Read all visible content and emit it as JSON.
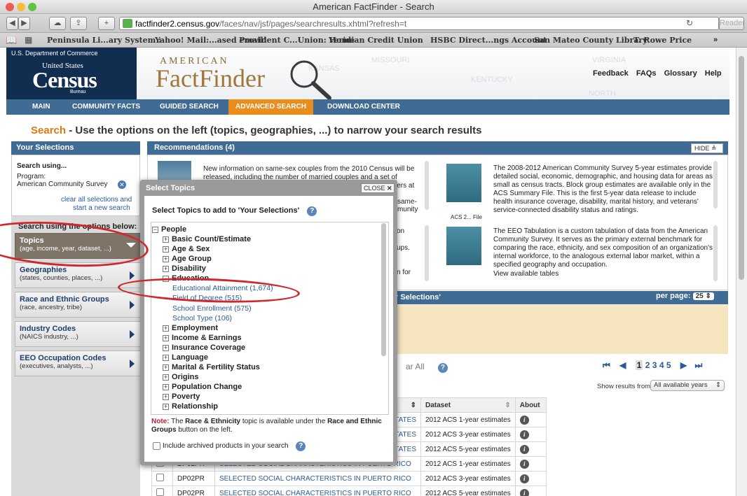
{
  "window": {
    "title": "American FactFinder - Search"
  },
  "toolbar": {
    "url_domain": "factfinder2.census.gov",
    "url_path": "/faces/nav/jsf/pages/searchresults.xhtml?refresh=t",
    "reader_label": "Reader"
  },
  "bookmarks": [
    "Peninsula Li...ary System :",
    "Yahoo! Mail:...ased email!",
    "Provident C...Union: Home",
    "Veridian Credit Union",
    "HSBC Direct...ngs Account",
    "San Mateo County Library",
    "T. Rowe Price"
  ],
  "header": {
    "dept": "U.S. Department of Commerce",
    "united_states": "United States",
    "census": "Census",
    "bureau": "Bureau",
    "american": "AMERICAN",
    "factfinder": "FactFinder",
    "map_labels": [
      "KANSAS",
      "MISSOURI",
      "KENTUCKY",
      "VIRGINIA",
      "NORTH"
    ],
    "links": [
      "Feedback",
      "FAQs",
      "Glossary",
      "Help"
    ]
  },
  "nav": [
    "MAIN",
    "COMMUNITY FACTS",
    "GUIDED SEARCH",
    "ADVANCED SEARCH",
    "DOWNLOAD CENTER"
  ],
  "heading": {
    "search": "Search",
    "rest": " - Use the options on the left (topics, geographies, ...) to narrow your search results"
  },
  "left": {
    "your_selections": "Your Selections",
    "search_using": "Search using...",
    "program_label": "Program:",
    "program_value": "American Community Survey",
    "clear_all": "clear all selections and",
    "start_new": "start a new search",
    "options_label": "Search using the options below:",
    "buttons": [
      {
        "title": "Topics",
        "sub": "(age, income, year, dataset, ...)"
      },
      {
        "title": "Geographies",
        "sub": "(states, counties, places, ...)"
      },
      {
        "title": "Race and Ethnic Groups",
        "sub": "(race, ancestry, tribe)"
      },
      {
        "title": "Industry Codes",
        "sub": "(NAICS industry, ...)"
      },
      {
        "title": "EEO Occupation Codes",
        "sub": "(executives, analysts, ...)"
      }
    ]
  },
  "recommendations": {
    "title": "Recommendations (4)",
    "hide": "HIDE",
    "item1": "New information on same-sex couples from the 2010 Census will be released, including the number of married couples and a set of preferred estimates of same-sex spouses and unmarried partners at the national and state levels. These estimates were",
    "item1_tail": [
      "same-",
      "munity"
    ],
    "item2_tail": [
      "on",
      "ups.",
      "n for"
    ],
    "item3": "The 2008-2012 American Community Survey 5-year estimates provide detailed social, economic, demographic, and housing data for areas as small as census tracts. Block group estimates are available only in the ACS Summary File. This is the first 5-year data release to include health insurance coverage, disability, marital history, and veterans' service-connected disability status and ratings.",
    "item3_link": "ACS 2...   File",
    "item4": "The EEO Tabulation is a custom tabulation of data from the American Community Survey. It serves as the primary external benchmark for comparing the race, ethnicity, and sex composition of an organization's internal workforce, to the analogous external labor market, within a specified geography and occupation.",
    "item4_link": "View available tables"
  },
  "results": {
    "head_tail": "r Selections'",
    "per_page_label": "per page:",
    "per_page_value": "25",
    "clear_all": "ar All",
    "pages": [
      "1",
      "2",
      "3",
      "4",
      "5"
    ],
    "show_from": "Show results from:",
    "years": "All available years",
    "col_dataset": "Dataset",
    "col_about": "About",
    "rows": [
      {
        "id": "",
        "title": "STATES",
        "dataset": "2012 ACS 1-year estimates"
      },
      {
        "id": "",
        "title": "STATES",
        "dataset": "2012 ACS 3-year estimates"
      },
      {
        "id": "",
        "title": "STATES",
        "dataset": "2012 ACS 5-year estimates"
      },
      {
        "id": "DP02PR",
        "title": "SELECTED SOCIAL CHARACTERISTICS IN PUERTO RICO",
        "dataset": "2012 ACS 1-year estimates"
      },
      {
        "id": "DP02PR",
        "title": "SELECTED SOCIAL CHARACTERISTICS IN PUERTO RICO",
        "dataset": "2012 ACS 3-year estimates"
      },
      {
        "id": "DP02PR",
        "title": "SELECTED SOCIAL CHARACTERISTICS IN PUERTO RICO",
        "dataset": "2012 ACS 5-year estimates"
      }
    ]
  },
  "modal": {
    "title": "Select Topics",
    "close": "CLOSE",
    "subtitle": "Select Topics to add to 'Your Selections'",
    "tree": [
      {
        "label": "People",
        "level": 0,
        "expanded": true
      },
      {
        "label": "Basic Count/Estimate",
        "level": 1
      },
      {
        "label": "Age & Sex",
        "level": 1
      },
      {
        "label": "Age Group",
        "level": 1
      },
      {
        "label": "Disability",
        "level": 1
      },
      {
        "label": "Education",
        "level": 1,
        "expanded": true
      }
    ],
    "education_items": [
      "Educational Attainment (1,674)",
      "Field of Degree (515)",
      "School Enrollment (575)",
      "School Type (106)"
    ],
    "more": [
      "Employment",
      "Income & Earnings",
      "Insurance Coverage",
      "Language",
      "Marital & Fertility Status",
      "Origins",
      "Population Change",
      "Poverty",
      "Relationship"
    ],
    "note_prefix": "Note:",
    "note_a": " The ",
    "note_race": "Race & Ethnicity",
    "note_b": " topic is available under the ",
    "note_btn": "Race and Ethnic Groups",
    "note_c": " button on the left.",
    "archive": "Include archived products in your search"
  },
  "colors": {
    "nav": "#3f6b94",
    "accent": "#e98d1c",
    "annotation": "#d1262b"
  }
}
